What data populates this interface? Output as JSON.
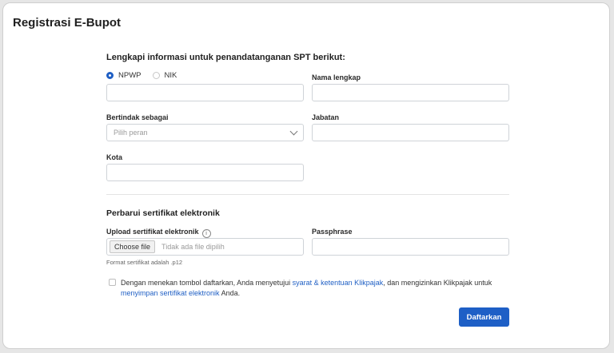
{
  "page": {
    "title": "Registrasi E-Bupot"
  },
  "signer": {
    "heading": "Lengkapi informasi untuk penandatanganan SPT berikut:",
    "id_type": {
      "options": [
        "NPWP",
        "NIK"
      ],
      "selected": "NPWP"
    },
    "id_value": "",
    "full_name": {
      "label": "Nama lengkap",
      "value": ""
    },
    "role": {
      "label": "Bertindak sebagai",
      "placeholder": "Pilih peran"
    },
    "position": {
      "label": "Jabatan",
      "value": ""
    },
    "city": {
      "label": "Kota",
      "value": ""
    }
  },
  "certificate": {
    "heading": "Perbarui sertifikat elektronik",
    "upload": {
      "label": "Upload sertifikat elektronik",
      "button": "Choose file",
      "no_file": "Tidak ada file dipilih",
      "hint": "Format sertifikat adalah .p12"
    },
    "passphrase": {
      "label": "Passphrase",
      "value": ""
    }
  },
  "agreement": {
    "text_1": "Dengan menekan tombol daftarkan, Anda menyetujui ",
    "link_1": "syarat & ketentuan Klikpajak",
    "text_2": ", dan mengizinkan Klikpajak untuk ",
    "link_2": "menyimpan sertifikat elektronik",
    "text_3": " Anda.",
    "checked": false
  },
  "submit_label": "Daftarkan",
  "colors": {
    "primary": "#1e5fc6",
    "link": "#1f5fc4"
  }
}
